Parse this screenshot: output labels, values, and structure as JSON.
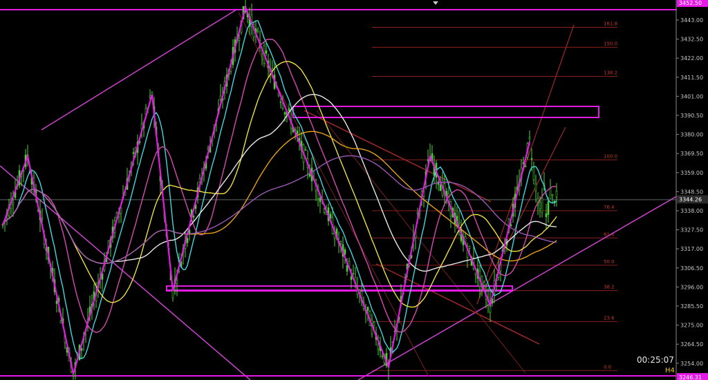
{
  "chart_data": {
    "type": "candlestick",
    "symbol_timeframe": "H4",
    "countdown": "00:25:07",
    "y_axis_ticks": [
      3254.0,
      3264.5,
      3275.0,
      3285.5,
      3296.0,
      3306.5,
      3317.0,
      3327.5,
      3338.0,
      3348.5,
      3359.0,
      3369.5,
      3380.0,
      3390.5,
      3401.0,
      3411.5,
      3422.0,
      3432.5,
      3443.0
    ],
    "ylim": [
      3246.31,
      3452.5
    ],
    "current_price": 3344.26,
    "high_marker": 3452.5,
    "low_marker": 3246.31,
    "fibonacci_levels": [
      {
        "label": "161.8",
        "price": 3439.0
      },
      {
        "label": "150.0",
        "price": 3428.0
      },
      {
        "label": "138.2",
        "price": 3412.0
      },
      {
        "label": "100.0",
        "price": 3366.0
      },
      {
        "label": "76.4",
        "price": 3338.0
      },
      {
        "label": "61.6",
        "price": 3323.0
      },
      {
        "label": "50.0",
        "price": 3308.0
      },
      {
        "label": "38.2",
        "price": 3294.0
      },
      {
        "label": "23.6",
        "price": 3277.0
      },
      {
        "label": "0.0",
        "price": 3250.0
      }
    ],
    "zigzag_pivots": [
      {
        "bar": 0,
        "price": 3330
      },
      {
        "bar": 12,
        "price": 3368
      },
      {
        "bar": 34,
        "price": 3248
      },
      {
        "bar": 72,
        "price": 3402
      },
      {
        "bar": 82,
        "price": 3294
      },
      {
        "bar": 117,
        "price": 3450
      },
      {
        "bar": 186,
        "price": 3252
      },
      {
        "bar": 206,
        "price": 3368
      },
      {
        "bar": 235,
        "price": 3286
      },
      {
        "bar": 254,
        "price": 3376
      }
    ],
    "colors": {
      "background": "#000000",
      "bull": "#4cd137",
      "zigzag": "#e61ae6",
      "channel": "#cc44cc",
      "fib": "#8b2020",
      "ma_yellow": "#f0e040",
      "ma_orange": "#e8a317",
      "ma_white": "#e8e8e8",
      "ma_cyan": "#40d8e0",
      "ma_violet": "#9b59b6",
      "ma_magenta": "#d64bb0"
    }
  }
}
